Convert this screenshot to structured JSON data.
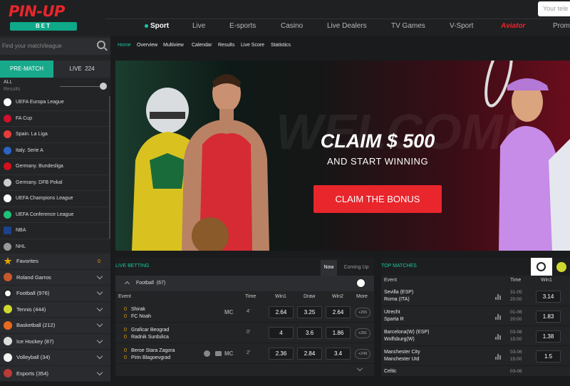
{
  "header": {
    "logo_main": "PIN-UP",
    "logo_sub": "BET",
    "search_placeholder": "Your tele",
    "nav": [
      {
        "label": "Sport",
        "active": true
      },
      {
        "label": "Live"
      },
      {
        "label": "E-sports"
      },
      {
        "label": "Casino"
      },
      {
        "label": "Live Dealers"
      },
      {
        "label": "TV Games"
      },
      {
        "label": "V-Sport"
      },
      {
        "label": "Aviator"
      },
      {
        "label": "Prom"
      }
    ]
  },
  "sidebar": {
    "search_placeholder": "Find your match/league",
    "tab_prematch": "PRE-MATCH",
    "tab_live": "LIVE",
    "live_count": "224",
    "all_label": "ALL",
    "results_label": "Results",
    "leagues": [
      {
        "label": "UEFA Europa League",
        "icon": "uefa-europa-icon",
        "color": "#ffffff"
      },
      {
        "label": "FA Cup",
        "icon": "fa-cup-icon",
        "color": "#d0102d"
      },
      {
        "label": "Spain. La Liga",
        "icon": "laliga-icon",
        "color": "#e73c3c"
      },
      {
        "label": "Italy. Serie A",
        "icon": "serie-a-icon",
        "color": "#2b64c4"
      },
      {
        "label": "Germany. Bundesliga",
        "icon": "bundesliga-icon",
        "color": "#d3111c"
      },
      {
        "label": "Germany. DFB Pokal",
        "icon": "dfb-pokal-icon",
        "color": "#cccccc"
      },
      {
        "label": "UEFA Champions League",
        "icon": "champions-league-icon",
        "color": "#ffffff"
      },
      {
        "label": "UEFA Conference League",
        "icon": "conference-league-icon",
        "color": "#1ec279"
      },
      {
        "label": "NBA",
        "icon": "nba-icon",
        "color": "#1d428a"
      },
      {
        "label": "NHL",
        "icon": "nhl-icon",
        "color": "#999999"
      }
    ],
    "sports": [
      {
        "label": "Favorites",
        "count": "0",
        "icon": "star-icon",
        "color": "#e3a300"
      },
      {
        "label": "Roland Garros",
        "icon": "roland-garros-icon",
        "color": "#c7582c"
      },
      {
        "label": "Football (976)",
        "icon": "football-icon",
        "color": "#ffffff"
      },
      {
        "label": "Tennis (444)",
        "icon": "tennis-icon",
        "color": "#cfd82e"
      },
      {
        "label": "Basketball (212)",
        "icon": "basketball-icon",
        "color": "#e86a1f"
      },
      {
        "label": "Ice Hockey (87)",
        "icon": "ice-hockey-icon",
        "color": "#dddddd"
      },
      {
        "label": "Volleyball (34)",
        "icon": "volleyball-icon",
        "color": "#f3f3f3"
      },
      {
        "label": "Esports (354)",
        "icon": "esports-icon",
        "color": "#bb3a3a"
      }
    ]
  },
  "subnav": [
    "Home",
    "Overview",
    "Multiview",
    "Calendar",
    "Results",
    "Live Score",
    "Statistics"
  ],
  "banner": {
    "headline": "CLAIM $ 500",
    "subline": "AND START WINNING",
    "button": "CLAIM THE BONUS",
    "watermark": "WELCOME"
  },
  "live_betting": {
    "title": "LIVE BETTING",
    "tab_now": "Now",
    "tab_upcoming": "Coming Up",
    "sport": "Football",
    "sport_count": "(67)",
    "columns": {
      "event": "Event",
      "time": "Time",
      "win1": "Win1",
      "draw": "Draw",
      "win2": "Win2",
      "more": "More"
    },
    "rows": [
      {
        "s1": "0",
        "t1": "Shirak",
        "s2": "0",
        "t2": "FC Noah",
        "mc": "MC",
        "time": "4'",
        "w1": "2.64",
        "d": "3.25",
        "w2": "2.64",
        "more": "+265"
      },
      {
        "s1": "0",
        "t1": "Graficar Beograd",
        "s2": "0",
        "t2": "Radnik Surdulica",
        "mc": "",
        "time": "0'",
        "w1": "4",
        "d": "3.6",
        "w2": "1.86",
        "more": "+281"
      },
      {
        "s1": "0",
        "t1": "Beroe Stara Zagora",
        "s2": "0",
        "t2": "Pirin Blagoevgrad",
        "mc": "MC",
        "time": "2'",
        "w1": "2.36",
        "d": "2.84",
        "w2": "3.4",
        "more": "+249"
      }
    ]
  },
  "top_matches": {
    "title": "TOP MATCHES",
    "columns": {
      "event": "Event",
      "time": "Time",
      "win1": "Win1"
    },
    "rows": [
      {
        "t1": "Sevilla (ESP)",
        "t2": "Roma (ITA)",
        "date": "31-05",
        "time": "20:00",
        "w1": "3.14"
      },
      {
        "t1": "Utrecht",
        "t2": "Sparta R",
        "date": "01-06",
        "time": "20:00",
        "w1": "1.83"
      },
      {
        "t1": "Barcelona(W) (ESP)",
        "t2": "Wolfsburg(W)",
        "date": "03-06",
        "time": "15:00",
        "w1": "1.38"
      },
      {
        "t1": "Manchester City",
        "t2": "Manchester Utd",
        "date": "03-06",
        "time": "15:00",
        "w1": "1.5"
      },
      {
        "t1": "Celtic",
        "t2": "",
        "date": "03-06",
        "time": "",
        "w1": ""
      }
    ]
  },
  "colors": {
    "accent": "#19c7a0",
    "brand_red": "#e8262c",
    "score_yellow": "#e3a300"
  }
}
